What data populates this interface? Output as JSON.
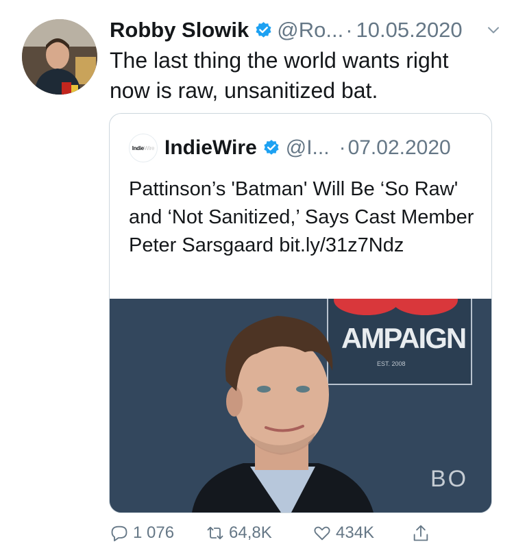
{
  "tweet": {
    "author_name": "Robby Slowik",
    "handle": "@Ro...",
    "separator": "·",
    "date": "10.05.2020",
    "text": "The last thing the world wants right now is raw, unsanitized bat."
  },
  "quoted_tweet": {
    "logo_text_a": "Indie",
    "logo_text_b": "Wire",
    "author_name": "IndieWire",
    "handle": "@I...",
    "separator": "·",
    "date": "07.02.2020",
    "text": "Pattinson’s 'Batman' Will Be ‘So Raw' and ‘Not Sanitized,’ Says Cast Member Peter Sarsgaard bit.ly/31z7Ndz",
    "image_text_top": "AMPAIGN",
    "image_text_est": "EST. 2008",
    "image_text_right": "BO"
  },
  "actions": {
    "reply_count": "1 076",
    "retweet_count": "64,8K",
    "like_count": "434K"
  },
  "colors": {
    "verified_blue": "#1da1f2",
    "muted_text": "#657786",
    "border": "#ccd6dd"
  }
}
